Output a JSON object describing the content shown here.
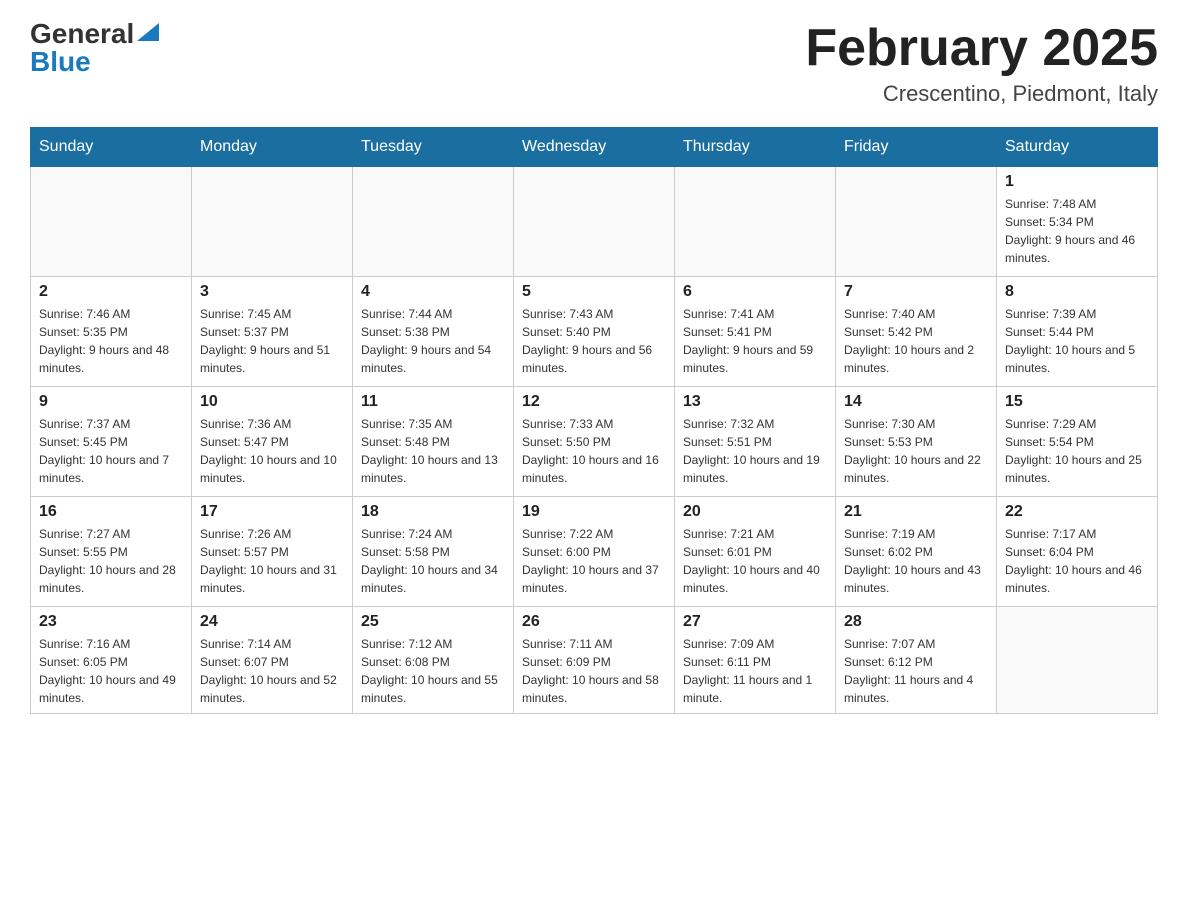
{
  "header": {
    "logo_general": "General",
    "logo_blue": "Blue",
    "month_title": "February 2025",
    "location": "Crescentino, Piedmont, Italy"
  },
  "days_of_week": [
    "Sunday",
    "Monday",
    "Tuesday",
    "Wednesday",
    "Thursday",
    "Friday",
    "Saturday"
  ],
  "weeks": [
    [
      {
        "day": "",
        "info": ""
      },
      {
        "day": "",
        "info": ""
      },
      {
        "day": "",
        "info": ""
      },
      {
        "day": "",
        "info": ""
      },
      {
        "day": "",
        "info": ""
      },
      {
        "day": "",
        "info": ""
      },
      {
        "day": "1",
        "info": "Sunrise: 7:48 AM\nSunset: 5:34 PM\nDaylight: 9 hours and 46 minutes."
      }
    ],
    [
      {
        "day": "2",
        "info": "Sunrise: 7:46 AM\nSunset: 5:35 PM\nDaylight: 9 hours and 48 minutes."
      },
      {
        "day": "3",
        "info": "Sunrise: 7:45 AM\nSunset: 5:37 PM\nDaylight: 9 hours and 51 minutes."
      },
      {
        "day": "4",
        "info": "Sunrise: 7:44 AM\nSunset: 5:38 PM\nDaylight: 9 hours and 54 minutes."
      },
      {
        "day": "5",
        "info": "Sunrise: 7:43 AM\nSunset: 5:40 PM\nDaylight: 9 hours and 56 minutes."
      },
      {
        "day": "6",
        "info": "Sunrise: 7:41 AM\nSunset: 5:41 PM\nDaylight: 9 hours and 59 minutes."
      },
      {
        "day": "7",
        "info": "Sunrise: 7:40 AM\nSunset: 5:42 PM\nDaylight: 10 hours and 2 minutes."
      },
      {
        "day": "8",
        "info": "Sunrise: 7:39 AM\nSunset: 5:44 PM\nDaylight: 10 hours and 5 minutes."
      }
    ],
    [
      {
        "day": "9",
        "info": "Sunrise: 7:37 AM\nSunset: 5:45 PM\nDaylight: 10 hours and 7 minutes."
      },
      {
        "day": "10",
        "info": "Sunrise: 7:36 AM\nSunset: 5:47 PM\nDaylight: 10 hours and 10 minutes."
      },
      {
        "day": "11",
        "info": "Sunrise: 7:35 AM\nSunset: 5:48 PM\nDaylight: 10 hours and 13 minutes."
      },
      {
        "day": "12",
        "info": "Sunrise: 7:33 AM\nSunset: 5:50 PM\nDaylight: 10 hours and 16 minutes."
      },
      {
        "day": "13",
        "info": "Sunrise: 7:32 AM\nSunset: 5:51 PM\nDaylight: 10 hours and 19 minutes."
      },
      {
        "day": "14",
        "info": "Sunrise: 7:30 AM\nSunset: 5:53 PM\nDaylight: 10 hours and 22 minutes."
      },
      {
        "day": "15",
        "info": "Sunrise: 7:29 AM\nSunset: 5:54 PM\nDaylight: 10 hours and 25 minutes."
      }
    ],
    [
      {
        "day": "16",
        "info": "Sunrise: 7:27 AM\nSunset: 5:55 PM\nDaylight: 10 hours and 28 minutes."
      },
      {
        "day": "17",
        "info": "Sunrise: 7:26 AM\nSunset: 5:57 PM\nDaylight: 10 hours and 31 minutes."
      },
      {
        "day": "18",
        "info": "Sunrise: 7:24 AM\nSunset: 5:58 PM\nDaylight: 10 hours and 34 minutes."
      },
      {
        "day": "19",
        "info": "Sunrise: 7:22 AM\nSunset: 6:00 PM\nDaylight: 10 hours and 37 minutes."
      },
      {
        "day": "20",
        "info": "Sunrise: 7:21 AM\nSunset: 6:01 PM\nDaylight: 10 hours and 40 minutes."
      },
      {
        "day": "21",
        "info": "Sunrise: 7:19 AM\nSunset: 6:02 PM\nDaylight: 10 hours and 43 minutes."
      },
      {
        "day": "22",
        "info": "Sunrise: 7:17 AM\nSunset: 6:04 PM\nDaylight: 10 hours and 46 minutes."
      }
    ],
    [
      {
        "day": "23",
        "info": "Sunrise: 7:16 AM\nSunset: 6:05 PM\nDaylight: 10 hours and 49 minutes."
      },
      {
        "day": "24",
        "info": "Sunrise: 7:14 AM\nSunset: 6:07 PM\nDaylight: 10 hours and 52 minutes."
      },
      {
        "day": "25",
        "info": "Sunrise: 7:12 AM\nSunset: 6:08 PM\nDaylight: 10 hours and 55 minutes."
      },
      {
        "day": "26",
        "info": "Sunrise: 7:11 AM\nSunset: 6:09 PM\nDaylight: 10 hours and 58 minutes."
      },
      {
        "day": "27",
        "info": "Sunrise: 7:09 AM\nSunset: 6:11 PM\nDaylight: 11 hours and 1 minute."
      },
      {
        "day": "28",
        "info": "Sunrise: 7:07 AM\nSunset: 6:12 PM\nDaylight: 11 hours and 4 minutes."
      },
      {
        "day": "",
        "info": ""
      }
    ]
  ]
}
